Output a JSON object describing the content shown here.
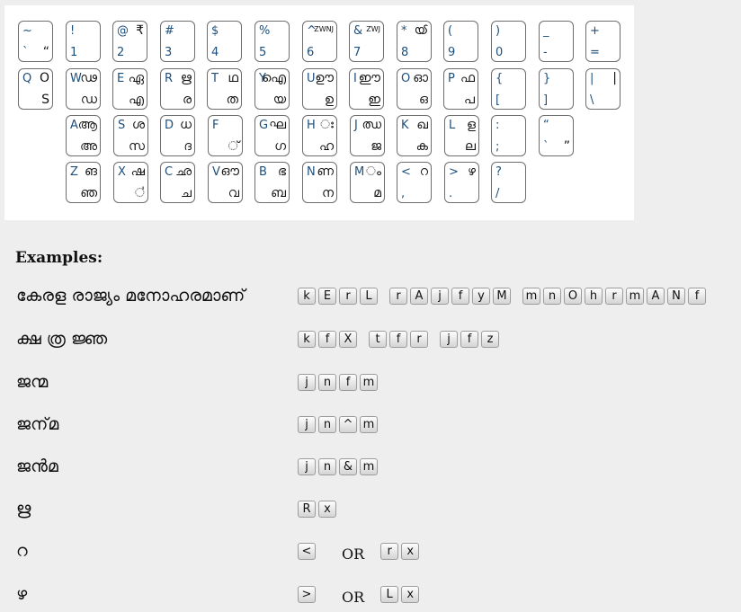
{
  "keyboard": {
    "rows": [
      [
        {
          "tl": "~",
          "bl": "`",
          "tr": "",
          "br": "“"
        },
        {
          "tl": "!",
          "bl": "1",
          "tr": "",
          "br": ""
        },
        {
          "tl": "@",
          "bl": "2",
          "tr": "₹",
          "br": ""
        },
        {
          "tl": "#",
          "bl": "3",
          "tr": "",
          "br": ""
        },
        {
          "tl": "$",
          "bl": "4",
          "tr": "",
          "br": ""
        },
        {
          "tl": "%",
          "bl": "5",
          "tr": "",
          "br": ""
        },
        {
          "tl": "^",
          "bl": "6",
          "tr": "ZWNJ",
          "br": ""
        },
        {
          "tl": "&",
          "bl": "7",
          "tr": "ZWJ",
          "br": ""
        },
        {
          "tl": "*",
          "bl": "8",
          "tr": "ൕ",
          "br": ""
        },
        {
          "tl": "(",
          "bl": "9",
          "tr": "",
          "br": ""
        },
        {
          "tl": ")",
          "bl": "0",
          "tr": "",
          "br": ""
        },
        {
          "tl": "_",
          "bl": "-",
          "tr": "",
          "br": ""
        },
        {
          "tl": "+",
          "bl": "=",
          "tr": "",
          "br": ""
        }
      ],
      [
        {
          "tl": "Q",
          "bl": "",
          "tr": "O",
          "br": "S"
        },
        {
          "tl": "W",
          "bl": "",
          "tr": "ഢ",
          "br": "ഡ"
        },
        {
          "tl": "E",
          "bl": "",
          "tr": "ഏ",
          "br": "എ"
        },
        {
          "tl": "R",
          "bl": "",
          "tr": "ഋ",
          "br": "ര"
        },
        {
          "tl": "T",
          "bl": "",
          "tr": "ഥ",
          "br": "ത"
        },
        {
          "tl": "Y",
          "bl": "",
          "tr": "ഐ",
          "br": "യ"
        },
        {
          "tl": "U",
          "bl": "",
          "tr": "ഊ",
          "br": "ഉ"
        },
        {
          "tl": "I",
          "bl": "",
          "tr": "ഈ",
          "br": "ഇ"
        },
        {
          "tl": "O",
          "bl": "",
          "tr": "ഓ",
          "br": "ഒ"
        },
        {
          "tl": "P",
          "bl": "",
          "tr": "ഫ",
          "br": "പ"
        },
        {
          "tl": "{",
          "bl": "[",
          "tr": "",
          "br": ""
        },
        {
          "tl": "}",
          "bl": "]",
          "tr": "",
          "br": ""
        },
        {
          "tl": "|",
          "bl": "\\",
          "tr": "|",
          "br": ""
        }
      ],
      [
        {
          "tl": "A",
          "bl": "",
          "tr": "ആ",
          "br": "അ"
        },
        {
          "tl": "S",
          "bl": "",
          "tr": "ശ",
          "br": "സ"
        },
        {
          "tl": "D",
          "bl": "",
          "tr": "ധ",
          "br": "ദ"
        },
        {
          "tl": "F",
          "bl": "",
          "tr": "",
          "br": "്"
        },
        {
          "tl": "G",
          "bl": "",
          "tr": "ഘ",
          "br": "ഗ"
        },
        {
          "tl": "H",
          "bl": "",
          "tr": "ഃ",
          "br": "ഹ"
        },
        {
          "tl": "J",
          "bl": "",
          "tr": "ഝ",
          "br": "ജ"
        },
        {
          "tl": "K",
          "bl": "",
          "tr": "ഖ",
          "br": "ക"
        },
        {
          "tl": "L",
          "bl": "",
          "tr": "ള",
          "br": "ല"
        },
        {
          "tl": ":",
          "bl": ";",
          "tr": "",
          "br": ""
        },
        {
          "tl": "“",
          "bl": "`",
          "tr": "",
          "br": "”"
        }
      ],
      [
        {
          "tl": "Z",
          "bl": "",
          "tr": "ങ",
          "br": "ഞ"
        },
        {
          "tl": "X",
          "bl": "",
          "tr": "ഷ",
          "br": "഻"
        },
        {
          "tl": "C",
          "bl": "",
          "tr": "ഛ",
          "br": "ച"
        },
        {
          "tl": "V",
          "bl": "",
          "tr": "ഔ",
          "br": "വ"
        },
        {
          "tl": "B",
          "bl": "",
          "tr": "ഭ",
          "br": "ബ"
        },
        {
          "tl": "N",
          "bl": "",
          "tr": "ണ",
          "br": "ന"
        },
        {
          "tl": "M",
          "bl": "",
          "tr": "ം",
          "br": "മ"
        },
        {
          "tl": "<",
          "bl": ",",
          "tr": "റ",
          "br": ""
        },
        {
          "tl": ">",
          "bl": ".",
          "tr": "ഴ",
          "br": ""
        },
        {
          "tl": "?",
          "bl": "/",
          "tr": "",
          "br": ""
        }
      ]
    ]
  },
  "examples": {
    "title": "Examples:",
    "or_label": "OR",
    "items": [
      {
        "word": "കേരള രാജ്യം മനോഹരമാണ്",
        "groups": [
          [
            "k",
            "E",
            "r",
            "L"
          ],
          [
            "r",
            "A",
            "j",
            "f",
            "y",
            "M"
          ],
          [
            "m",
            "n",
            "O",
            "h",
            "r",
            "m",
            "A",
            "N",
            "f"
          ]
        ]
      },
      {
        "word": "ക്ഷ ത്ര ജ്ഞ",
        "groups": [
          [
            "k",
            "f",
            "X"
          ],
          [
            "t",
            "f",
            "r"
          ],
          [
            "j",
            "f",
            "z"
          ]
        ]
      },
      {
        "word": "ജന്മ",
        "groups": [
          [
            "j",
            "n",
            "f",
            "m"
          ]
        ]
      },
      {
        "word": "ജന്‌മ",
        "groups": [
          [
            "j",
            "n",
            "^",
            "m"
          ]
        ]
      },
      {
        "word": "ജന്‍മ",
        "groups": [
          [
            "j",
            "n",
            "&",
            "m"
          ]
        ]
      },
      {
        "word": "ഋ",
        "groups": [
          [
            "R",
            "x"
          ]
        ]
      },
      {
        "word": "റ",
        "groups": [
          [
            "<"
          ]
        ],
        "alt": [
          [
            "r",
            "x"
          ]
        ]
      },
      {
        "word": "ഴ",
        "groups": [
          [
            ">"
          ]
        ],
        "alt": [
          [
            "L",
            "x"
          ]
        ]
      }
    ]
  }
}
